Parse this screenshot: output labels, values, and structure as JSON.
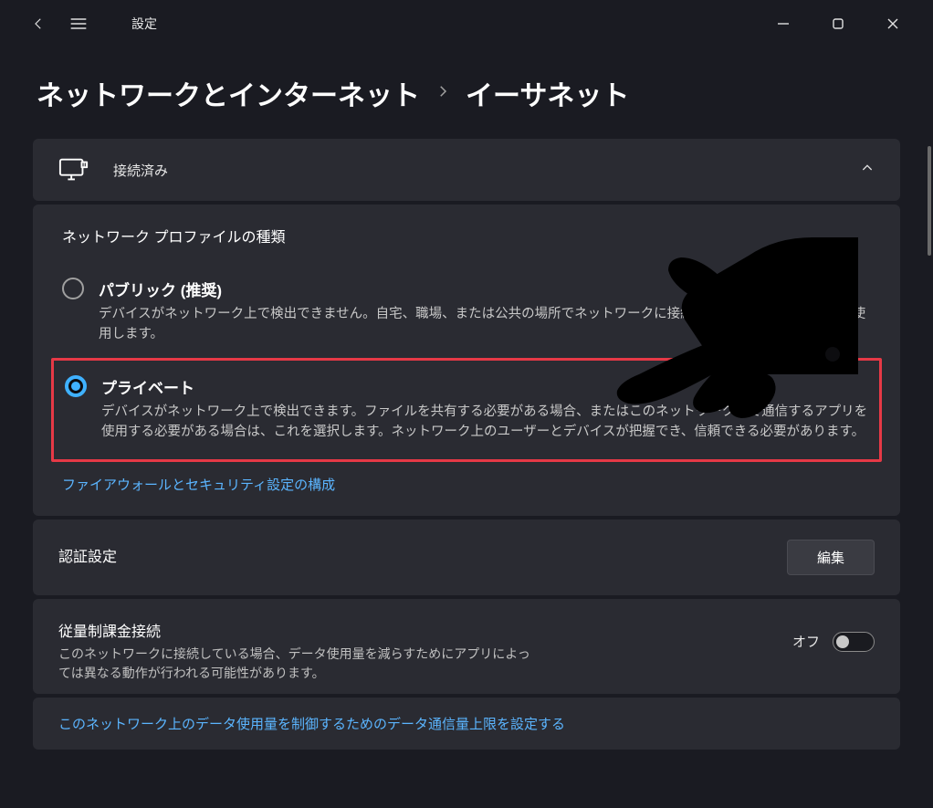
{
  "titlebar": {
    "app_title": "設定"
  },
  "breadcrumb": {
    "parent": "ネットワークとインターネット",
    "current": "イーサネット"
  },
  "connection": {
    "status": "接続済み"
  },
  "profile": {
    "heading": "ネットワーク プロファイルの種類",
    "public": {
      "label": "パブリック (推奨)",
      "desc": "デバイスがネットワーク上で検出できません。自宅、職場、または公共の場所でネットワークに接続した場合などには、これを使用します。"
    },
    "private": {
      "label": "プライベート",
      "desc": "デバイスがネットワーク上で検出できます。ファイルを共有する必要がある場合、またはこのネットワーク上で通信するアプリを使用する必要がある場合は、これを選択します。ネットワーク上のユーザーとデバイスが把握でき、信頼できる必要があります。"
    },
    "firewall_link": "ファイアウォールとセキュリティ設定の構成"
  },
  "auth": {
    "title": "認証設定",
    "edit_label": "編集"
  },
  "metered": {
    "title": "従量制課金接続",
    "desc": "このネットワークに接続している場合、データ使用量を減らすためにアプリによっては異なる動作が行われる可能性があります。",
    "toggle_state": "オフ",
    "limit_link": "このネットワーク上のデータ使用量を制御するためのデータ通信量上限を設定する"
  }
}
